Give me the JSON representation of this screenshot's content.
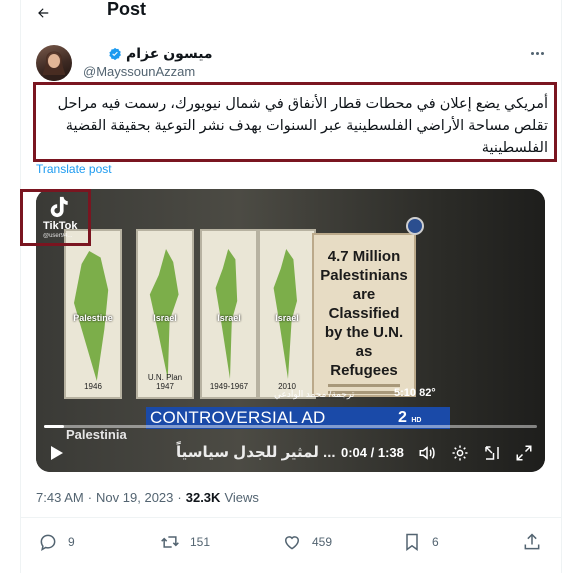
{
  "header": {
    "title": "Post",
    "back_icon": "arrow-left-icon"
  },
  "author": {
    "name": "ميسون عزام",
    "handle": "@MayssounAzzam",
    "verified": true,
    "verified_color": "#1d9bf0"
  },
  "tweet": {
    "text": "أمريكي يضع إعلان في محطات قطار الأنفاق في شمال نيويورك، رسمت فيه مراحل تقلص مساحة الأراضي الفلسطينية عبر السنوات بهدف نشر التوعية بحقيقة القضية الفلسطينية",
    "translate_label": "Translate post"
  },
  "video": {
    "tiktok_label": "TikTok",
    "tiktok_handle": "@user94...",
    "maps": [
      {
        "label": "Palestine",
        "year": "1946"
      },
      {
        "label": "Israel",
        "year": "U.N. Plan 1947"
      },
      {
        "label": "Israel",
        "year": "1949-1967"
      },
      {
        "label": "Israel",
        "year": "2010"
      }
    ],
    "billboard_text": "4.7 Million Palestinians are Classified by the U.N. as Refugees",
    "time_overlay": "5:10  82°",
    "translator_credit": "ترجمة/ محمد الوادعي",
    "banner": "CONTROVERSIAL AD",
    "station": "2",
    "station_hd": "HD",
    "lower_word": "Palestinia",
    "caption": "... لمثير للجدل سياسياً",
    "current_time": "0:04",
    "duration": "1:38",
    "progress": 0.04,
    "accent_box_color": "#7a1520"
  },
  "meta": {
    "time": "7:43 AM",
    "separator": "·",
    "date": "Nov 19, 2023",
    "views_count": "32.3K",
    "views_label": "Views"
  },
  "actions": {
    "reply_count": "9",
    "retweet_count": "151",
    "like_count": "459",
    "bookmark_count": "6"
  }
}
